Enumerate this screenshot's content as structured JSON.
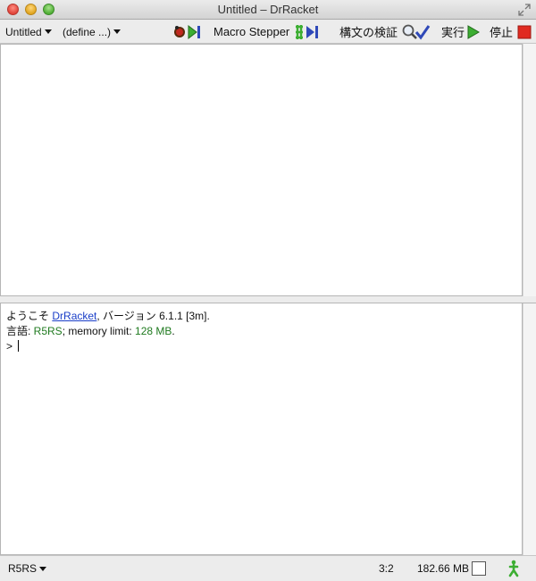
{
  "window": {
    "title": "Untitled – DrRacket"
  },
  "toolbar": {
    "file_menu_label": "Untitled",
    "define_menu_label": "(define ...)",
    "macro_stepper_label": "Macro Stepper",
    "check_syntax_label": "構文の検証",
    "run_label": "実行",
    "stop_label": "停止"
  },
  "interactions": {
    "welcome_prefix": "ようこそ",
    "welcome_link": "DrRacket",
    "welcome_suffix": ", バージョン 6.1.1 [3m].",
    "language_prefix": "言語: ",
    "language_value": "R5RS",
    "memory_prefix": "; memory limit: ",
    "memory_value": "128 MB",
    "memory_suffix": ".",
    "prompt": ">"
  },
  "statusbar": {
    "language_menu_label": "R5RS",
    "cursor_position": "3:2",
    "memory_usage": "182.66 MB"
  },
  "colors": {
    "run_green": "#3cae32",
    "stop_red": "#e02a20",
    "link_blue": "#1a3ec8",
    "value_green": "#1f7a1f"
  }
}
